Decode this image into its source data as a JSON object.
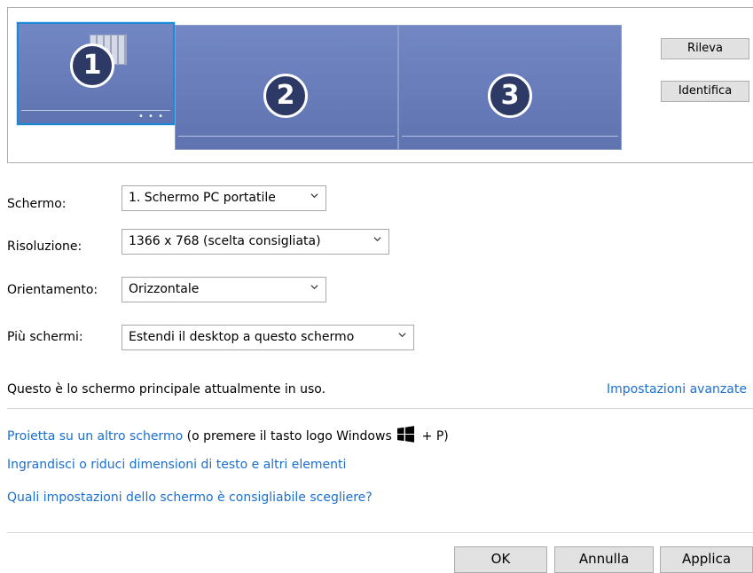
{
  "monitors": [
    {
      "number": "1",
      "selected": true
    },
    {
      "number": "2",
      "selected": false
    },
    {
      "number": "3",
      "selected": false
    }
  ],
  "buttons": {
    "detect": "Rileva",
    "identify": "Identifica",
    "ok": "OK",
    "cancel": "Annulla",
    "apply": "Applica"
  },
  "fields": {
    "display": {
      "label": "Schermo:",
      "value": "1. Schermo PC portatile"
    },
    "resolution": {
      "label": "Risoluzione:",
      "value": "1366 x 768 (scelta consigliata)"
    },
    "orientation": {
      "label": "Orientamento:",
      "value": "Orizzontale"
    },
    "multiple_displays": {
      "label": "Più schermi:",
      "value": "Estendi il desktop a questo schermo"
    }
  },
  "status": {
    "primary_text": "Questo è lo schermo principale attualmente in uso.",
    "advanced_link": "Impostazioni avanzate"
  },
  "links": {
    "project_link": "Proietta su un altro schermo",
    "project_hint_prefix": " (o premere il tasto logo Windows ",
    "project_hint_suffix": " + P)",
    "text_size_link": "Ingrandisci o riduci dimensioni di testo e altri elementi",
    "which_settings_link": "Quali impostazioni dello schermo è consigliabile scegliere?"
  },
  "colors": {
    "link": "#1a6fd0",
    "monitor_fill": "#6a7fbd",
    "selection_border": "#1a8ad8"
  },
  "icons": {
    "chevron": "chevron-down-icon",
    "windows_logo": "windows-logo-icon"
  }
}
